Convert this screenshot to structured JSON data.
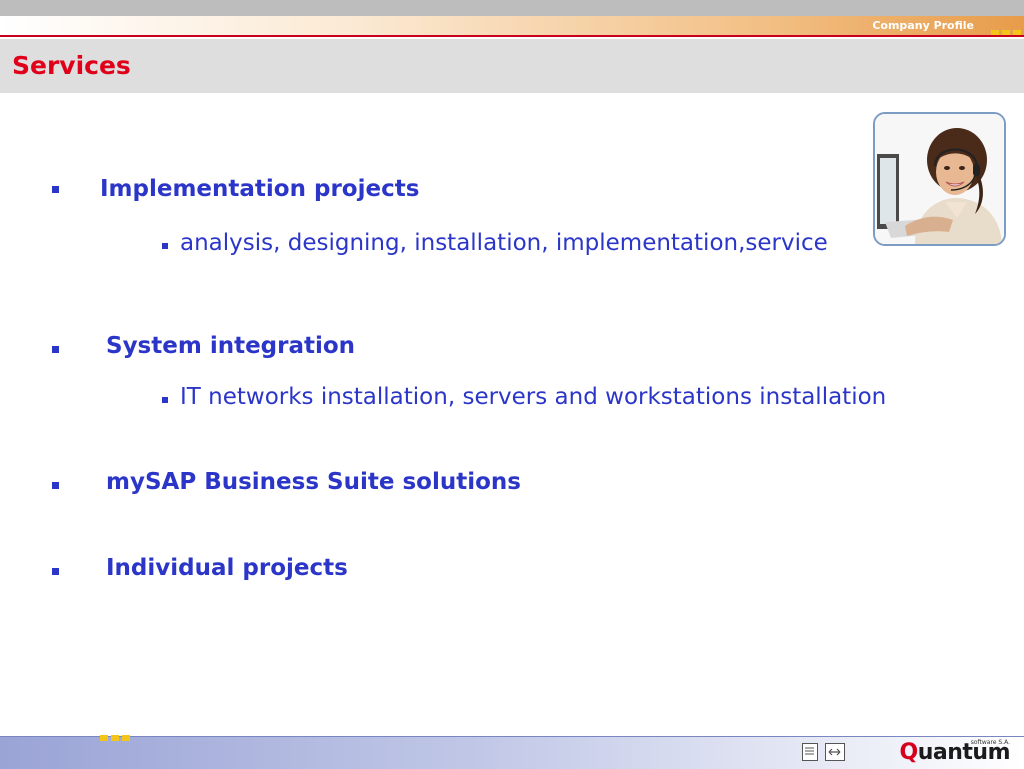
{
  "header": {
    "section_label": "Company Profile",
    "title": "Services"
  },
  "services": [
    {
      "heading": "Implementation projects",
      "detail": "analysis, designing, installation, implementation,service"
    },
    {
      "heading": "System integration",
      "detail": "IT networks installation, servers and workstations installation"
    },
    {
      "heading": "mySAP Business Suite solutions",
      "detail": ""
    },
    {
      "heading": "Individual projects",
      "detail": ""
    }
  ],
  "footer": {
    "logo_word": "uantum",
    "logo_letter": "Q",
    "logo_tagline": "software S.A."
  },
  "colors": {
    "title_red": "#e0001a",
    "text_blue": "#2b36c8",
    "accent_yellow": "#f4c519"
  },
  "icons": [
    "document-icon",
    "window-arrows-icon"
  ]
}
